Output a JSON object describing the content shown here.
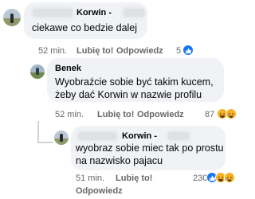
{
  "comments": [
    {
      "author": "Korwin -",
      "text_lines": [
        "ciekawe co bedzie dalej"
      ],
      "time": "52 min.",
      "like_label": "Lubię to!",
      "reply_label": "Odpowiedz",
      "reaction_count": "5",
      "reactions": [
        "like-icon"
      ]
    },
    {
      "author": "Benek",
      "text_lines": [
        "Wyobraźcie sobie być takim kucem,",
        "żeby dać Korwin w nazwie profilu"
      ],
      "time": "52 min.",
      "like_label": "Lubię to!",
      "reply_label": "Odpowiedz",
      "reaction_count": "87",
      "reactions": [
        "haha-icon",
        "haha-icon"
      ]
    },
    {
      "author": "Korwin -",
      "text_lines": [
        "wyobraz sobie miec tak po prostu",
        "na nazwisko pajacu"
      ],
      "time": "51 min.",
      "like_label": "Lubię to!",
      "reply_label": "Odpowiedz",
      "reaction_count": "230",
      "reactions": [
        "like-icon",
        "haha-icon",
        "haha-icon"
      ]
    }
  ],
  "colors": {
    "bubble": "#f0f2f5",
    "meta_text": "#65676b",
    "like_blue": "#1877f2",
    "haha_yellow": "#f7b125"
  }
}
